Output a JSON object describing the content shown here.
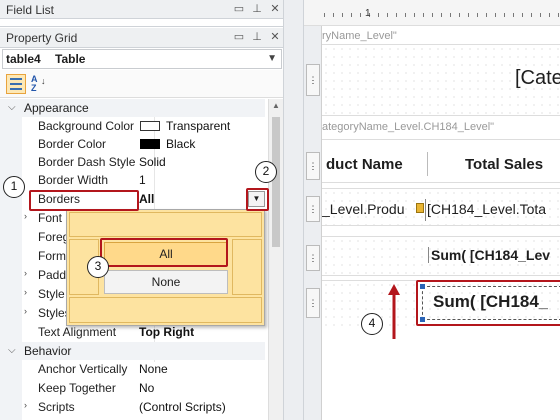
{
  "field_list": {
    "title": "Field List"
  },
  "property_grid": {
    "title": "Property Grid",
    "selected_object": {
      "name": "table4",
      "type": "Table"
    },
    "toolbar": {
      "categorized_icon": "categorized-icon",
      "alphabetical_icon": "sort-az-icon",
      "alphabetical_glyph": "A Z"
    }
  },
  "appearance": {
    "category": "Appearance",
    "rows": [
      {
        "name": "Background Color",
        "value": "Transparent",
        "swatch": "#ffffff"
      },
      {
        "name": "Border Color",
        "value": "Black",
        "swatch": "#000000"
      },
      {
        "name": "Border Dash Style",
        "value": "Solid"
      },
      {
        "name": "Border Width",
        "value": "1"
      },
      {
        "name": "Borders",
        "value": "All"
      },
      {
        "name": "Font",
        "value": ""
      },
      {
        "name": "Foreg",
        "value": ""
      },
      {
        "name": "Forma",
        "value": ""
      },
      {
        "name": "Paddi",
        "value": ""
      },
      {
        "name": "Style",
        "value": ""
      },
      {
        "name": "Styles",
        "value": ""
      },
      {
        "name": "Text Alignment",
        "value": "Top Right"
      }
    ]
  },
  "behavior": {
    "category": "Behavior",
    "rows": [
      {
        "name": "Anchor Vertically",
        "value": "None"
      },
      {
        "name": "Keep Together",
        "value": "No"
      },
      {
        "name": "Scripts",
        "value": "(Control Scripts)"
      }
    ]
  },
  "borders_dropdown": {
    "all_label": "All",
    "none_label": "None"
  },
  "callouts": [
    "1",
    "2",
    "3",
    "4"
  ],
  "designer": {
    "ruler_tick": "1",
    "band1_label": "ryName_Level\"",
    "band2_label": "ategoryName_Level.CH184_Level\"",
    "cat_header": "[Cate",
    "col_product": "duct Name",
    "col_sales": "Total Sales",
    "row_product": "_Level.Produ",
    "row_sales": "[CH184_Level.Tota",
    "group_sum": "Sum( [CH184_Lev",
    "footer_sum": "Sum( [CH184_"
  },
  "colors": {
    "accent_red": "#b3161c",
    "dropdown_bg": "#fde3a0",
    "selected_item": "#ffd98a"
  }
}
